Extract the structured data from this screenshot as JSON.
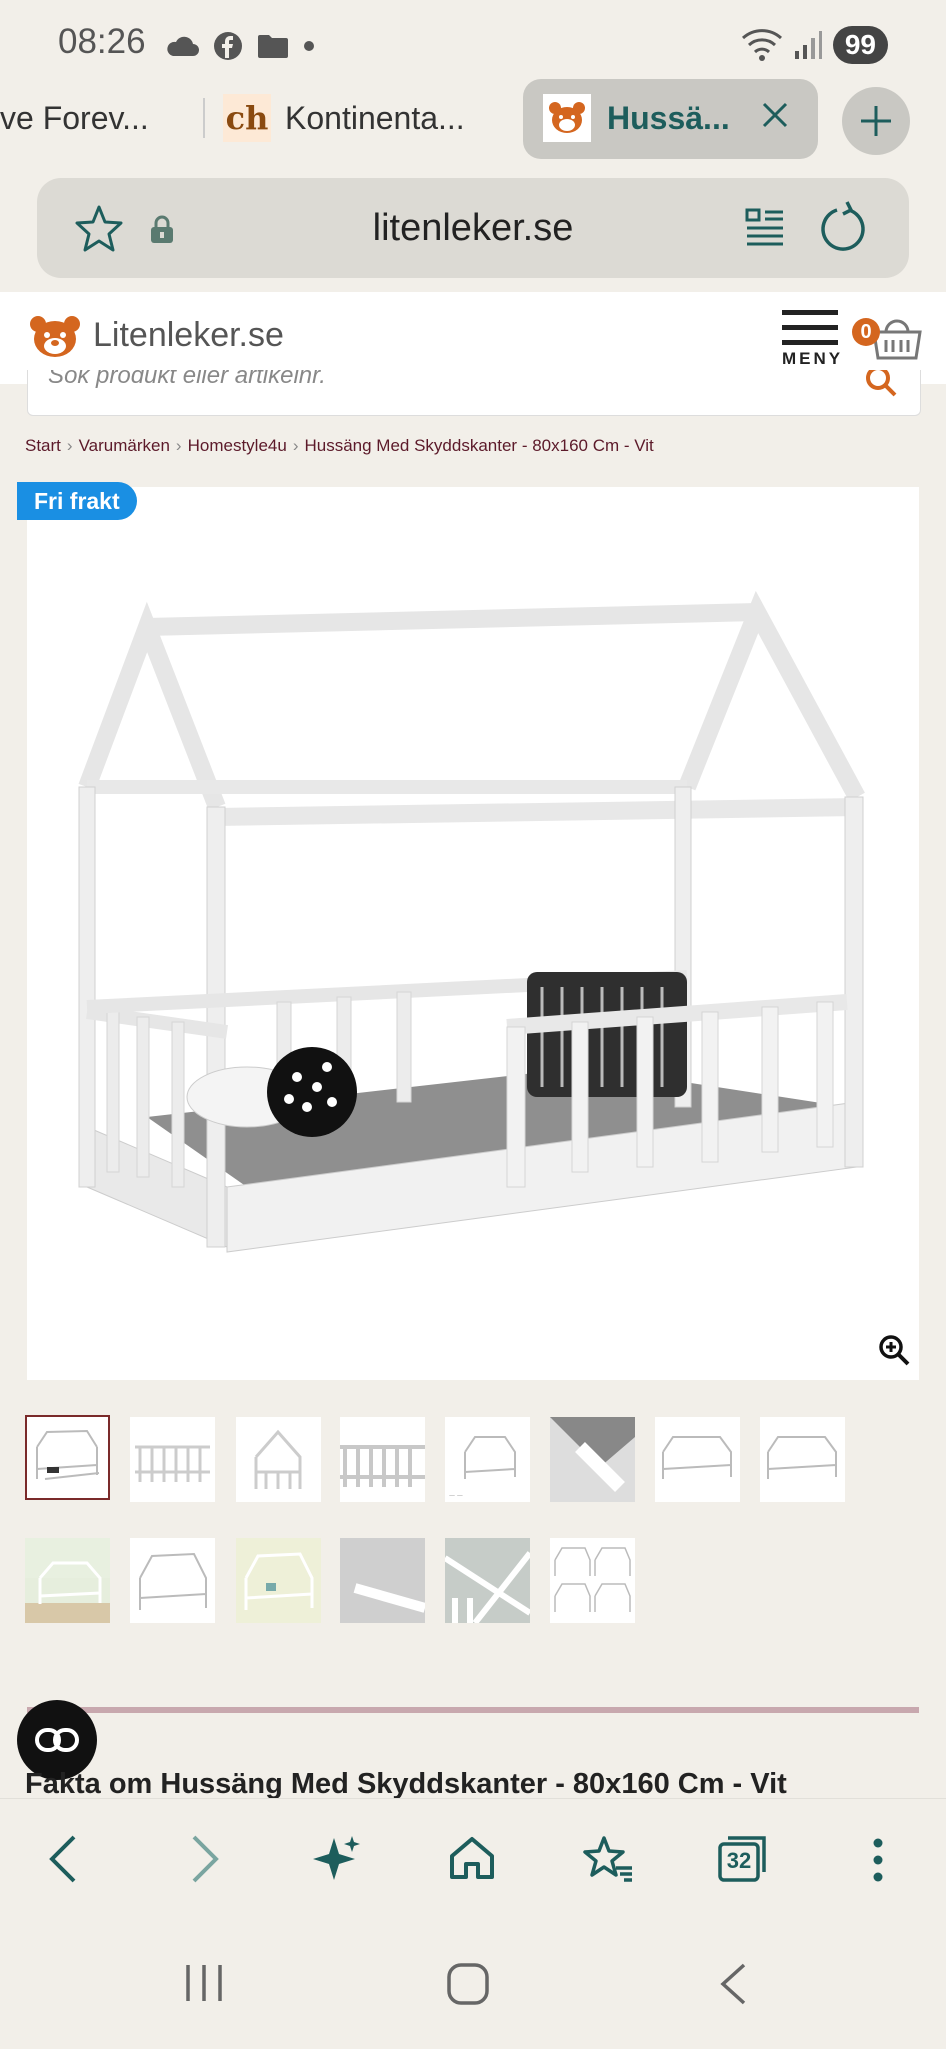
{
  "status": {
    "time": "08:26",
    "battery": "99"
  },
  "tabs": [
    {
      "label": "ve Forev..."
    },
    {
      "label": "Kontinenta..."
    },
    {
      "label": "Hussä..."
    }
  ],
  "tab_icons": {
    "second_icon_text": "ch"
  },
  "url": {
    "domain": "litenleker.se"
  },
  "site": {
    "logo": "Litenleker.se",
    "menu_label": "MENY",
    "cart_count": "0",
    "search_placeholder": "Sök produkt eller artikelnr."
  },
  "breadcrumb": [
    "Start",
    "Varumärken",
    "Homestyle4u",
    "Hussäng Med Skyddskanter - 80x160 Cm - Vit"
  ],
  "product": {
    "badge": "Fri frakt",
    "fakta_title": "Fakta om Hussäng Med Skyddskanter - 80x160 Cm - Vit"
  },
  "bottom_bar": {
    "tab_count": "32"
  },
  "colors": {
    "accent_green": "#1d5d5c",
    "brand_orange": "#d4661f",
    "badge_blue": "#1a8fe3",
    "breadcrumb_color": "#5c1a2a"
  }
}
